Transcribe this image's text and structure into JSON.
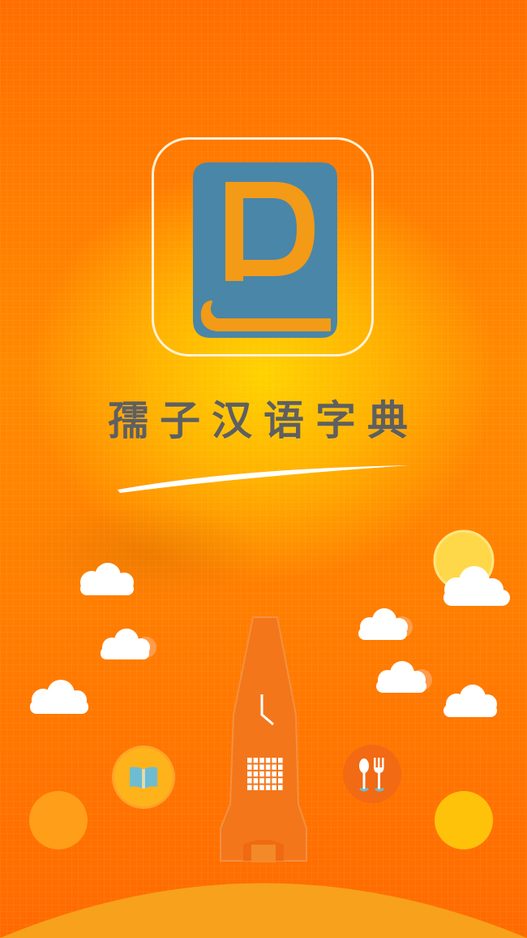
{
  "app": {
    "title": "孺子汉语字典"
  },
  "logo": {
    "letter": "D",
    "colors": {
      "book": "#4a86a8",
      "letter": "#f39a17",
      "frame": "#fff2d6"
    }
  },
  "scene": {
    "icons": [
      "logo-book-icon",
      "sun-icon",
      "cloud-icon",
      "rocket-tower-icon",
      "clock-icon",
      "calendar-grid-icon",
      "open-book-icon",
      "spoon-fork-icon"
    ]
  },
  "colors": {
    "background_top": "#ff6e00",
    "glow": "#ffd200",
    "title_text": "#5f5f5f",
    "hill": "#f7a11c"
  }
}
